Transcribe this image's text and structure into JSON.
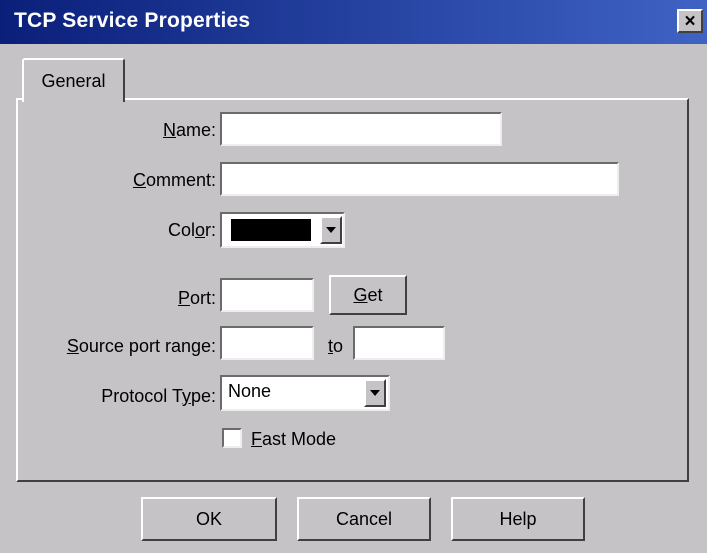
{
  "dialog": {
    "title": "TCP Service Properties",
    "close_glyph": "×"
  },
  "tabs": [
    {
      "label": "General"
    }
  ],
  "fields": {
    "name": {
      "label": "Name:",
      "value": ""
    },
    "comment": {
      "label": "Comment:",
      "value": ""
    },
    "color": {
      "label": "Color:",
      "value": "#000000"
    },
    "port": {
      "label": "Port:",
      "value": ""
    },
    "source_port_range": {
      "label": "Source port range:",
      "from_value": "",
      "to_label": "to",
      "to_value": ""
    },
    "protocol_type": {
      "label": "Protocol Type:",
      "value": "None"
    },
    "fast_mode": {
      "label": "Fast Mode",
      "checked": false
    }
  },
  "buttons": {
    "get": "Get",
    "ok": "OK",
    "cancel": "Cancel",
    "help": "Help"
  },
  "colors": {
    "titlebar_start": "#0a1f7a",
    "titlebar_end": "#3f63c4",
    "face": "#c6c3c6"
  }
}
